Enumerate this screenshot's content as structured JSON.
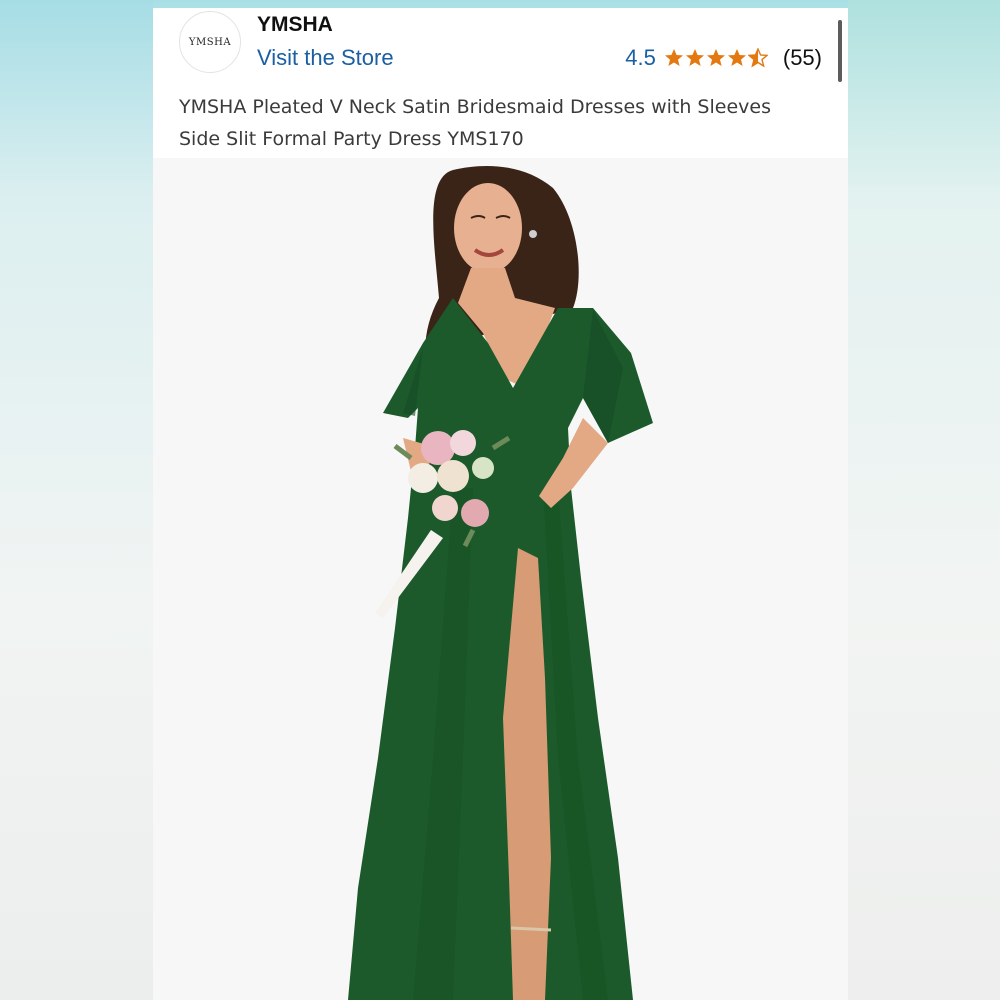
{
  "store": {
    "logo_text": "YMSHA",
    "name": "YMSHA",
    "visit_label": "Visit the Store"
  },
  "rating": {
    "value": "4.5",
    "stars": 4.5,
    "count": "(55)",
    "star_color": "#e47911"
  },
  "product": {
    "title": "YMSHA Pleated V Neck Satin Bridesmaid Dresses with Sleeves Side Slit Formal Party Dress YMS170",
    "dress_color": "#1c5a2c",
    "image_icon": "product-photo-model-green-dress"
  },
  "colors": {
    "link": "#1a5fa3",
    "text": "#3b3b3b"
  }
}
